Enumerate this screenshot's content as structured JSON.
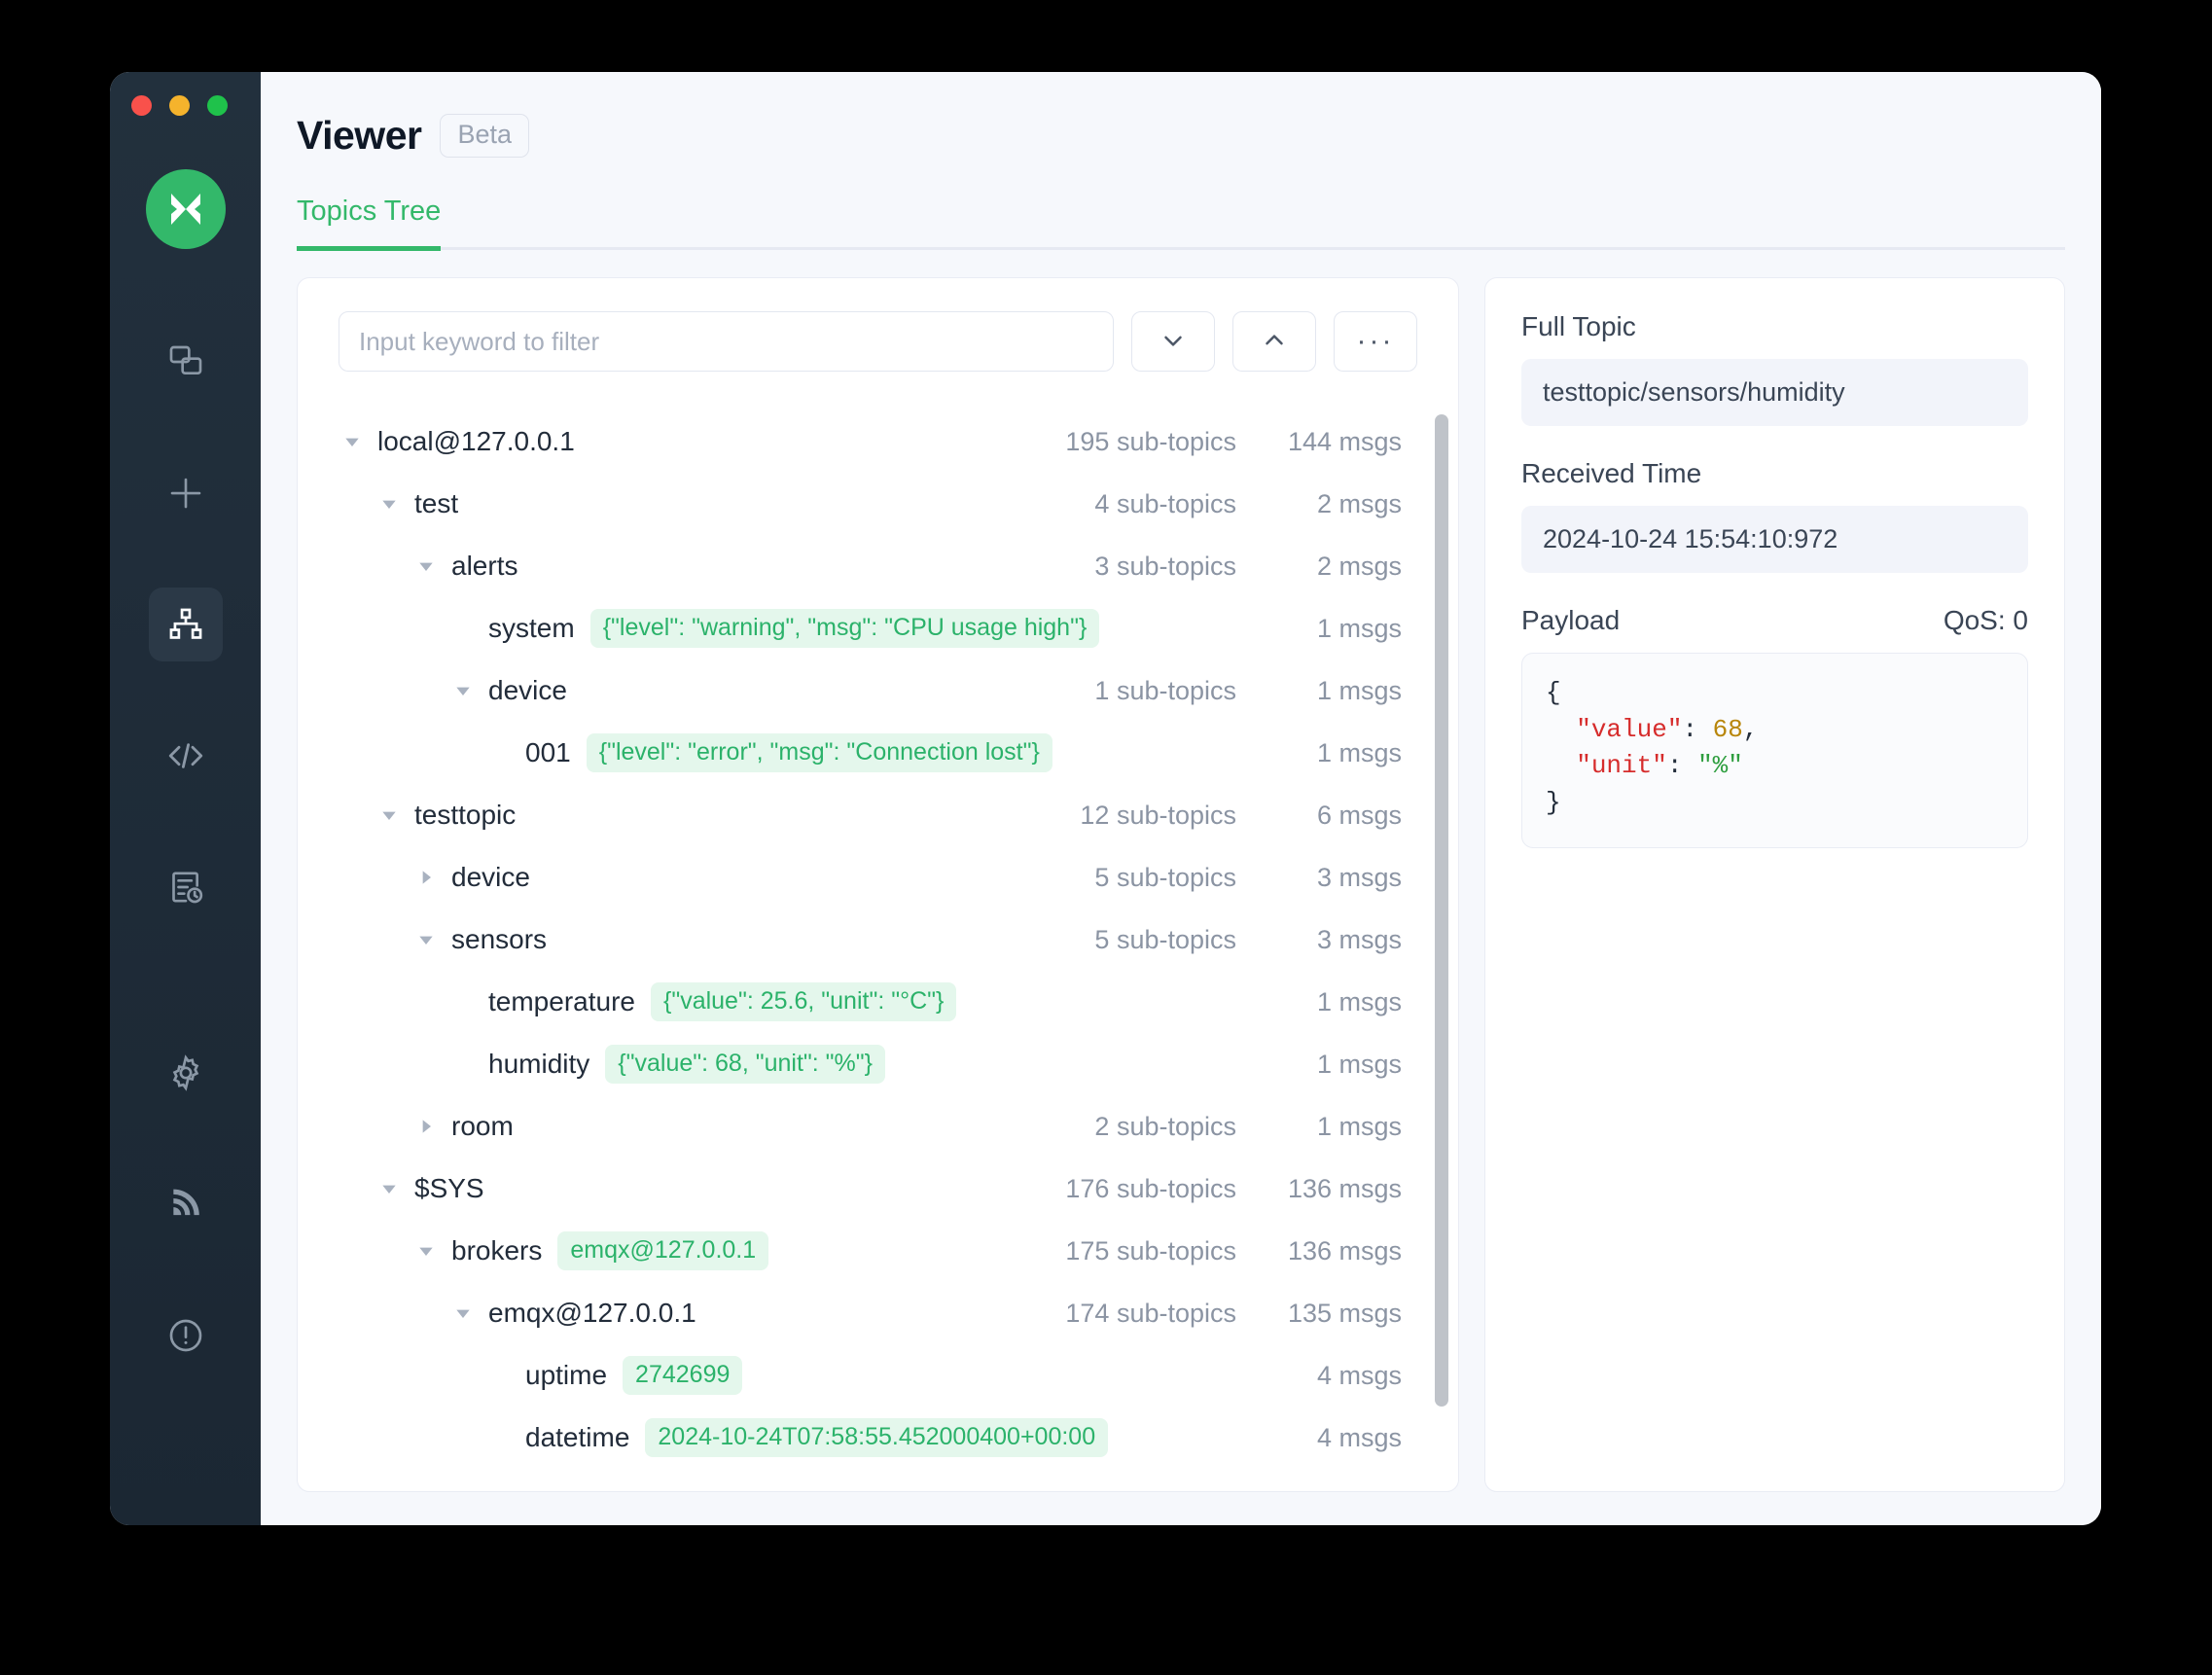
{
  "window": {
    "traffic_lights": [
      "close",
      "minimize",
      "maximize"
    ],
    "brand_icon": "emqx-logo-icon"
  },
  "sidebar": {
    "items": [
      {
        "name": "connections",
        "icon": "copy-windows-icon",
        "active": false
      },
      {
        "name": "new-connection",
        "icon": "plus-icon",
        "active": false
      },
      {
        "name": "topics-tree",
        "icon": "sitemap-icon",
        "active": true
      },
      {
        "name": "scripts",
        "icon": "code-brackets-icon",
        "active": false
      },
      {
        "name": "log",
        "icon": "document-clock-icon",
        "active": false
      },
      {
        "name": "settings",
        "icon": "gear-icon",
        "active": false
      },
      {
        "name": "broadcast",
        "icon": "rss-signal-icon",
        "active": false
      },
      {
        "name": "about",
        "icon": "exclamation-circle-icon",
        "active": false
      }
    ]
  },
  "header": {
    "title": "Viewer",
    "badge": "Beta"
  },
  "tabs": [
    {
      "label": "Topics Tree",
      "active": true
    }
  ],
  "toolbar": {
    "filter_placeholder": "Input keyword to filter",
    "filter_value": "",
    "expand_all_icon": "chevron-down-icon",
    "collapse_all_icon": "chevron-up-icon",
    "more_label": "···"
  },
  "tree": {
    "rows": [
      {
        "depth": 0,
        "caret": "down",
        "label": "local@127.0.0.1",
        "badge": "",
        "subtopics": "195 sub-topics",
        "msgs": "144 msgs"
      },
      {
        "depth": 1,
        "caret": "down",
        "label": "test",
        "badge": "",
        "subtopics": "4 sub-topics",
        "msgs": "2 msgs"
      },
      {
        "depth": 2,
        "caret": "down",
        "label": "alerts",
        "badge": "",
        "subtopics": "3 sub-topics",
        "msgs": "2 msgs"
      },
      {
        "depth": 3,
        "caret": "none",
        "label": "system",
        "badge": "{\"level\": \"warning\", \"msg\": \"CPU usage high\"}",
        "subtopics": "",
        "msgs": "1 msgs"
      },
      {
        "depth": 3,
        "caret": "down",
        "label": "device",
        "badge": "",
        "subtopics": "1 sub-topics",
        "msgs": "1 msgs"
      },
      {
        "depth": 4,
        "caret": "none",
        "label": "001",
        "badge": "{\"level\": \"error\", \"msg\": \"Connection lost\"}",
        "subtopics": "",
        "msgs": "1 msgs"
      },
      {
        "depth": 1,
        "caret": "down",
        "label": "testtopic",
        "badge": "",
        "subtopics": "12 sub-topics",
        "msgs": "6 msgs"
      },
      {
        "depth": 2,
        "caret": "right",
        "label": "device",
        "badge": "",
        "subtopics": "5 sub-topics",
        "msgs": "3 msgs"
      },
      {
        "depth": 2,
        "caret": "down",
        "label": "sensors",
        "badge": "",
        "subtopics": "5 sub-topics",
        "msgs": "3 msgs"
      },
      {
        "depth": 3,
        "caret": "none",
        "label": "temperature",
        "badge": "{\"value\": 25.6, \"unit\": \"°C\"}",
        "subtopics": "",
        "msgs": "1 msgs"
      },
      {
        "depth": 3,
        "caret": "none",
        "label": "humidity",
        "badge": "{\"value\": 68, \"unit\": \"%\"}",
        "subtopics": "",
        "msgs": "1 msgs"
      },
      {
        "depth": 2,
        "caret": "right",
        "label": "room",
        "badge": "",
        "subtopics": "2 sub-topics",
        "msgs": "1 msgs"
      },
      {
        "depth": 1,
        "caret": "down",
        "label": "$SYS",
        "badge": "",
        "subtopics": "176 sub-topics",
        "msgs": "136 msgs"
      },
      {
        "depth": 2,
        "caret": "down",
        "label": "brokers",
        "badge": "emqx@127.0.0.1",
        "subtopics": "175 sub-topics",
        "msgs": "136 msgs"
      },
      {
        "depth": 3,
        "caret": "down",
        "label": "emqx@127.0.0.1",
        "badge": "",
        "subtopics": "174 sub-topics",
        "msgs": "135 msgs"
      },
      {
        "depth": 4,
        "caret": "none",
        "label": "uptime",
        "badge": "2742699",
        "subtopics": "",
        "msgs": "4 msgs"
      },
      {
        "depth": 4,
        "caret": "none",
        "label": "datetime",
        "badge": "2024-10-24T07:58:55.452000400+00:00",
        "subtopics": "",
        "msgs": "4 msgs"
      }
    ]
  },
  "detail": {
    "full_topic_label": "Full Topic",
    "full_topic_value": "testtopic/sensors/humidity",
    "received_time_label": "Received Time",
    "received_time_value": "2024-10-24 15:54:10:972",
    "payload_label": "Payload",
    "qos_label": "QoS: 0",
    "payload_lines": [
      {
        "open": "{"
      },
      {
        "key": "\"value\"",
        "sep": ": ",
        "num": "68",
        "tail": ","
      },
      {
        "key": "\"unit\"",
        "sep": ": ",
        "str": "\"%\"",
        "tail": ""
      },
      {
        "close": "}"
      }
    ]
  },
  "colors": {
    "accent_green": "#33b86a",
    "badge_bg": "#e4f7ec",
    "badge_text": "#2bb26a",
    "sidebar_bg": "#1f2b38",
    "page_bg": "#f6f8fc"
  }
}
